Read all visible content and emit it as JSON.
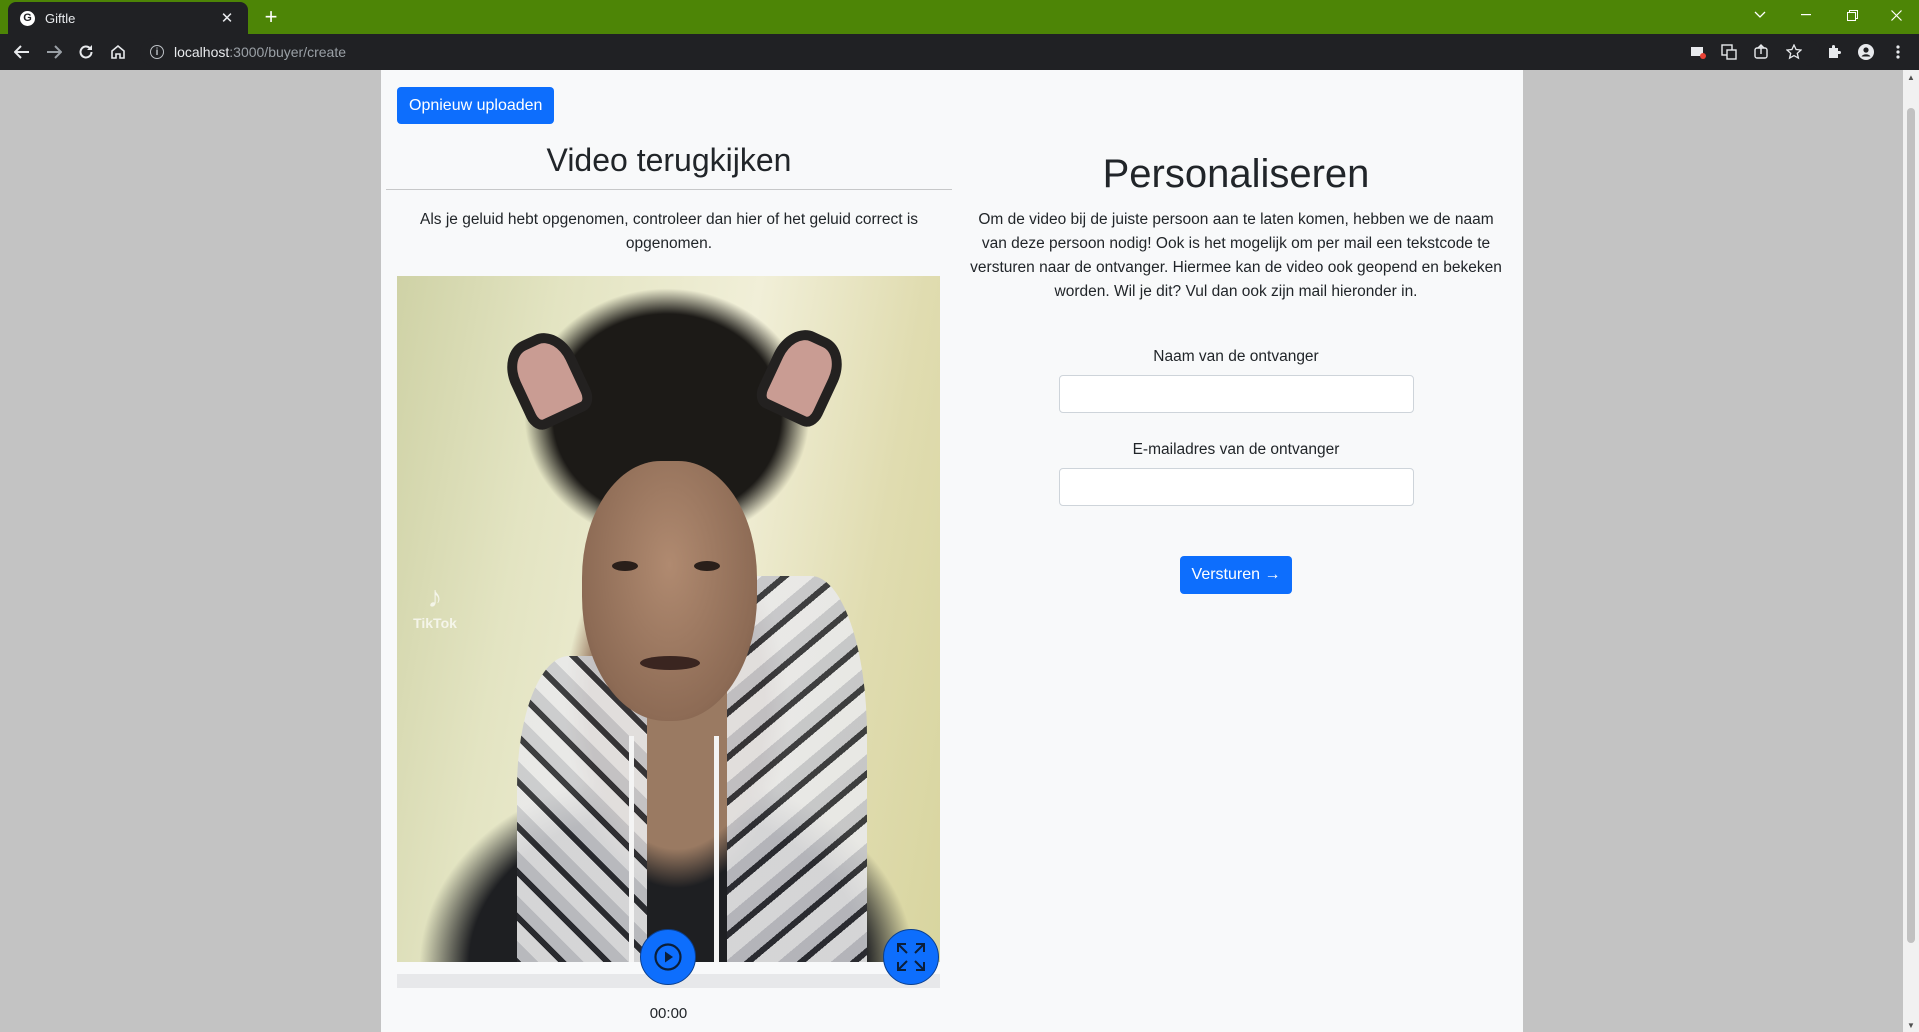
{
  "browser": {
    "tab_title": "Giftle",
    "tab_favicon": "G",
    "tab_close": "✕",
    "new_tab": "+",
    "url_host": "localhost",
    "url_path": ":3000/buyer/create",
    "window_controls": [
      "chevron-down-icon",
      "minimize-icon",
      "restore-icon",
      "close-icon"
    ],
    "toolbar_icons": [
      "extension-blocked-icon",
      "translate-icon",
      "share-icon",
      "bookmark-star-icon",
      "puzzle-icon",
      "profile-icon",
      "menu-kebab-icon"
    ]
  },
  "colors": {
    "tabstrip": "#4d8506",
    "primary": "#0d6efd",
    "page_bg": "#f8f9fa",
    "outer_bg": "#c3c3c3"
  },
  "page": {
    "reupload_button": "Opnieuw uploaden",
    "left": {
      "title": "Video terugkijken",
      "description": "Als je geluid hebt opgenomen, controleer dan hier of het geluid correct is opgenomen.",
      "video_watermark": "TikTok",
      "time": "00:00",
      "progress": 0
    },
    "right": {
      "title": "Personaliseren",
      "description": "Om de video bij de juiste persoon aan te laten komen, hebben we de naam van deze persoon nodig! Ook is het mogelijk om per mail een tekstcode te versturen naar de ontvanger. Hiermee kan de video ook geopend en bekeken worden. Wil je dit? Vul dan ook zijn mail hieronder in.",
      "name_label": "Naam van de ontvanger",
      "name_value": "",
      "email_label": "E-mailadres van de ontvanger",
      "email_value": "",
      "submit_button": "Versturen →"
    }
  }
}
